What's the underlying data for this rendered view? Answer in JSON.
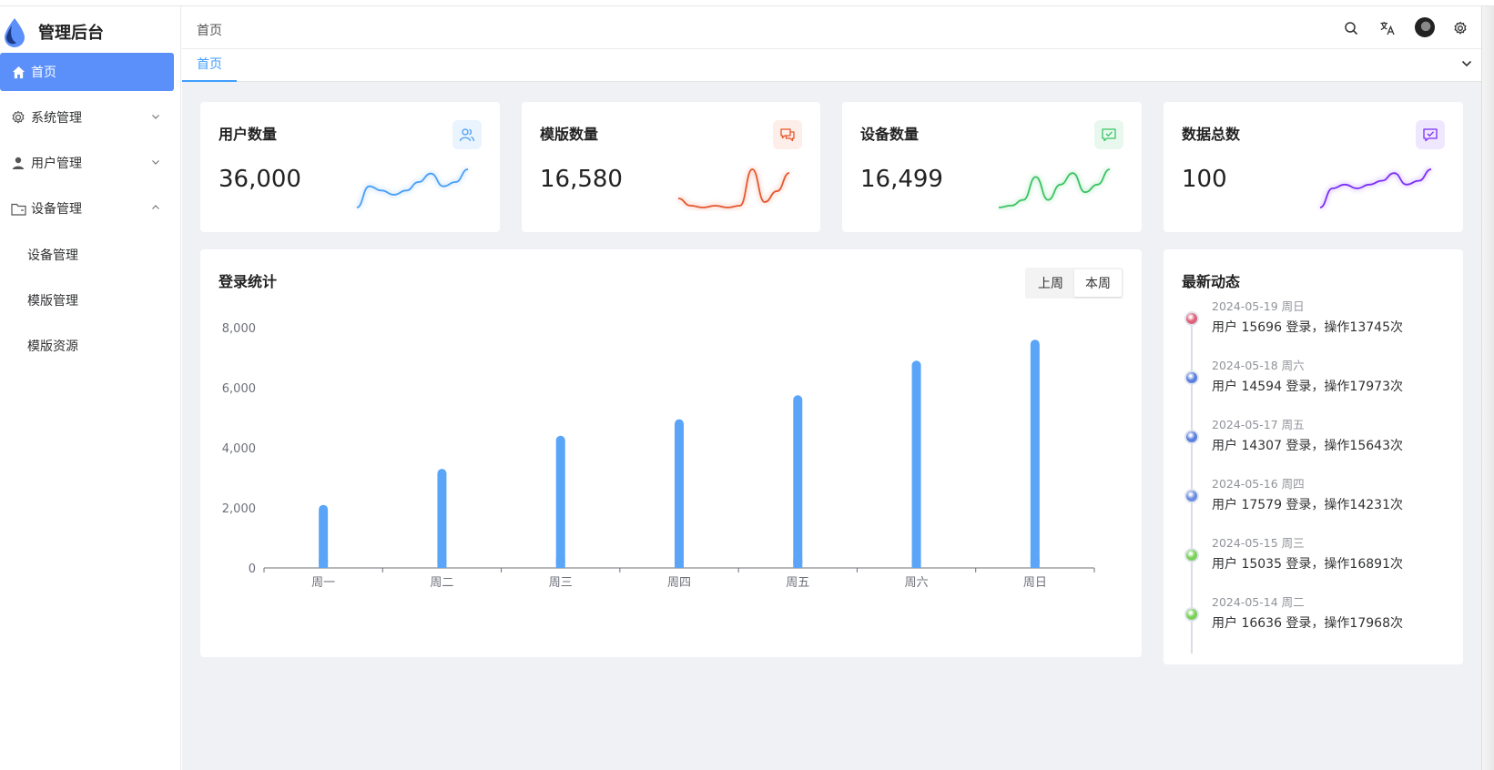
{
  "app": {
    "title": "管理后台"
  },
  "sidebar": {
    "items": [
      {
        "label": "首页",
        "icon": "home-icon",
        "active": true
      },
      {
        "label": "系统管理",
        "icon": "gear-icon",
        "expanded": false
      },
      {
        "label": "用户管理",
        "icon": "user-icon",
        "expanded": false
      },
      {
        "label": "设备管理",
        "icon": "folder-icon",
        "expanded": true
      }
    ],
    "submenu": [
      "设备管理",
      "模版管理",
      "模版资源"
    ]
  },
  "header": {
    "breadcrumb": "首页",
    "icons": [
      "search-icon",
      "translate-icon",
      "avatar",
      "settings-icon"
    ]
  },
  "tabs": [
    {
      "label": "首页"
    }
  ],
  "stats": [
    {
      "title": "用户数量",
      "value": "36,000",
      "color": "#4a9ff5",
      "badge_bg": "#eaf4fe",
      "icon": "users-icon",
      "spark": [
        3,
        8,
        7,
        6,
        7,
        9,
        11,
        8,
        9,
        12
      ]
    },
    {
      "title": "模版数量",
      "value": "16,580",
      "color": "#e4572e",
      "badge_bg": "#fdeee9",
      "icon": "chat-icon",
      "spark": [
        4,
        2,
        1.5,
        2,
        1.5,
        2,
        12,
        3,
        6,
        11
      ]
    },
    {
      "title": "设备数量",
      "value": "16,499",
      "color": "#39c463",
      "badge_bg": "#e8f8ee",
      "icon": "message-check-icon",
      "spark": [
        1,
        1.5,
        3,
        9,
        3,
        7,
        10,
        5,
        7,
        11
      ]
    },
    {
      "title": "数据总数",
      "value": "100",
      "color": "#7b2ff7",
      "badge_bg": "#efe7fd",
      "icon": "message-check-icon",
      "spark": [
        1,
        6,
        7,
        6,
        7,
        8,
        10,
        7,
        8,
        11
      ]
    }
  ],
  "login_panel": {
    "title": "登录统计",
    "toggle": [
      "上周",
      "本周"
    ],
    "active_toggle": "本周"
  },
  "chart_data": {
    "type": "bar",
    "categories": [
      "周一",
      "周二",
      "周三",
      "周四",
      "周五",
      "周六",
      "周日"
    ],
    "values": [
      2100,
      3300,
      4400,
      4950,
      5750,
      6900,
      7600
    ],
    "ylim": [
      0,
      8000
    ],
    "yticks": [
      "0",
      "2,000",
      "4,000",
      "6,000",
      "8,000"
    ],
    "color": "#5aa5f8",
    "title": "",
    "xlabel": "",
    "ylabel": ""
  },
  "activity": {
    "title": "最新动态",
    "items": [
      {
        "date": "2024-05-19 周日",
        "text": "用户 15696 登录，操作13745次",
        "dot": "#e0627a"
      },
      {
        "date": "2024-05-18 周六",
        "text": "用户 14594 登录，操作17973次",
        "dot": "#5b7fe0"
      },
      {
        "date": "2024-05-17 周五",
        "text": "用户 14307 登录，操作15643次",
        "dot": "#5b7fe0"
      },
      {
        "date": "2024-05-16 周四",
        "text": "用户 17579 登录，操作14231次",
        "dot": "#6a8be0"
      },
      {
        "date": "2024-05-15 周三",
        "text": "用户 15035 登录，操作16891次",
        "dot": "#7bd15a"
      },
      {
        "date": "2024-05-14 周二",
        "text": "用户 16636 登录，操作17968次",
        "dot": "#7bd15a"
      }
    ]
  }
}
